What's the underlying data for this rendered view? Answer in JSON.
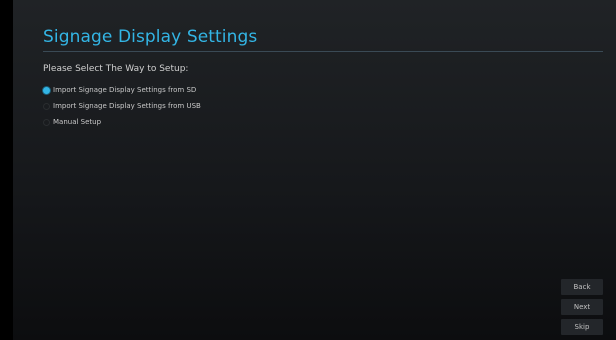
{
  "header": {
    "title": "Signage Display Settings"
  },
  "main": {
    "prompt": "Please Select The Way to Setup:",
    "options": [
      {
        "label": "Import Signage Display Settings from SD",
        "selected": true
      },
      {
        "label": "Import Signage Display Settings from USB",
        "selected": false
      },
      {
        "label": "Manual Setup",
        "selected": false
      }
    ]
  },
  "nav": {
    "back_label": "Back",
    "next_label": "Next",
    "skip_label": "Skip"
  },
  "colors": {
    "accent": "#33b5e5",
    "background": "#1a1c1f"
  }
}
